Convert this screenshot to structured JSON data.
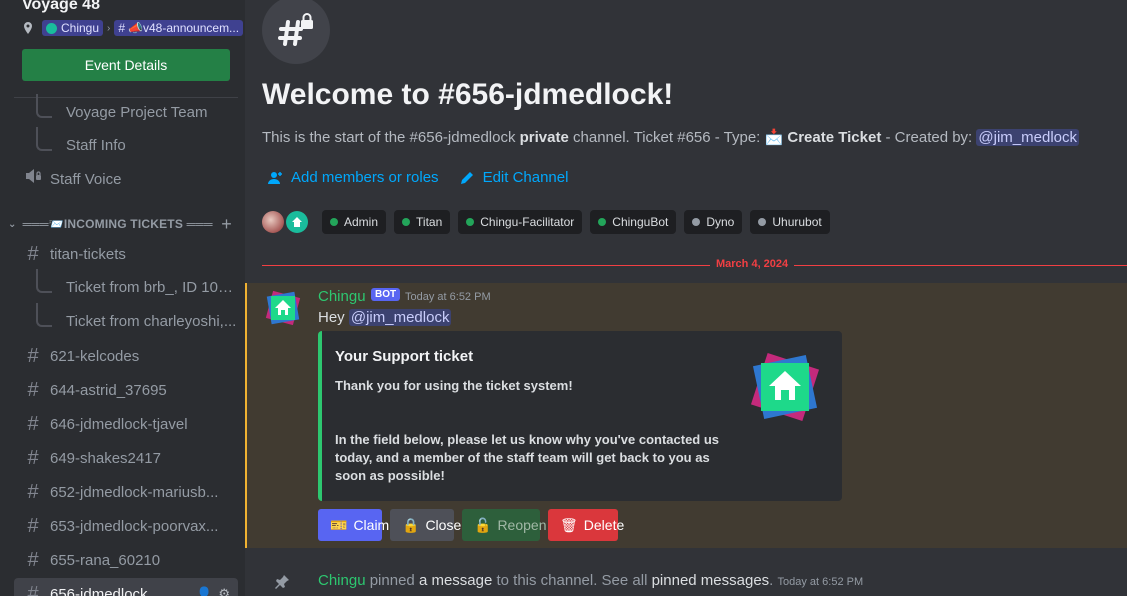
{
  "sidebar": {
    "server_name": "Voyage 48",
    "breadcrumb": {
      "server": "Chingu",
      "channel": "📣v48-announcem..."
    },
    "event_button": "Event Details",
    "top_threads": [
      "Voyage Project Team",
      "Staff Info"
    ],
    "voice_channel": "Staff Voice",
    "category": "═══📨INCOMING TICKETS ═══",
    "channels": [
      {
        "type": "text",
        "name": "titan-tickets"
      },
      {
        "type": "thread",
        "name": "Ticket from brb_, ID 109..."
      },
      {
        "type": "thread",
        "name": "Ticket from charleyoshi,..."
      },
      {
        "type": "text",
        "name": "621-kelcodes"
      },
      {
        "type": "text",
        "name": "644-astrid_37695"
      },
      {
        "type": "text",
        "name": "646-jdmedlock-tjavel"
      },
      {
        "type": "text",
        "name": "649-shakes2417"
      },
      {
        "type": "text",
        "name": "652-jdmedlock-mariusb..."
      },
      {
        "type": "text",
        "name": "653-jdmedlock-poorvax..."
      },
      {
        "type": "text",
        "name": "655-rana_60210"
      },
      {
        "type": "text",
        "name": "656-jdmedlock",
        "active": true
      }
    ]
  },
  "channel_header": {
    "welcome": "Welcome to #656-jdmedlock!",
    "sub_prefix": "This is the start of the #656-jdmedlock",
    "sub_bold": "private",
    "sub_mid": "channel. Ticket #656 - Type:",
    "sub_type": "Create Ticket",
    "sub_created": "- Created by:",
    "sub_mention": "@jim_medlock",
    "add_members": "Add members or roles",
    "edit_channel": "Edit Channel"
  },
  "roles": [
    {
      "name": "Admin",
      "color": "#23a55a"
    },
    {
      "name": "Titan",
      "color": "#23a55a"
    },
    {
      "name": "Chingu-Facilitator",
      "color": "#23a55a"
    },
    {
      "name": "ChinguBot",
      "color": "#23a55a"
    },
    {
      "name": "Dyno",
      "color": "#949ba4"
    },
    {
      "name": "Uhurubot",
      "color": "#949ba4"
    }
  ],
  "date_divider": "March 4, 2024",
  "message": {
    "author": "Chingu",
    "badge": "BOT",
    "timestamp": "Today at 6:52 PM",
    "text": "Hey",
    "mention": "@jim_medlock",
    "embed": {
      "title": "Your Support ticket",
      "line1": "Thank you for using the ticket system!",
      "line2": "In the field below, please let us know why you've contacted us today, and a member of the staff team will get back to you as soon as possible!"
    },
    "buttons": {
      "claim": "Claim",
      "close": "Close",
      "reopen": "Reopen",
      "delete": "Delete"
    }
  },
  "system_message": {
    "author": "Chingu",
    "text1": "pinned",
    "link1": "a message",
    "text2": "to this channel. See all",
    "link2": "pinned messages",
    "text3": ".",
    "timestamp": "Today at 6:52 PM"
  }
}
